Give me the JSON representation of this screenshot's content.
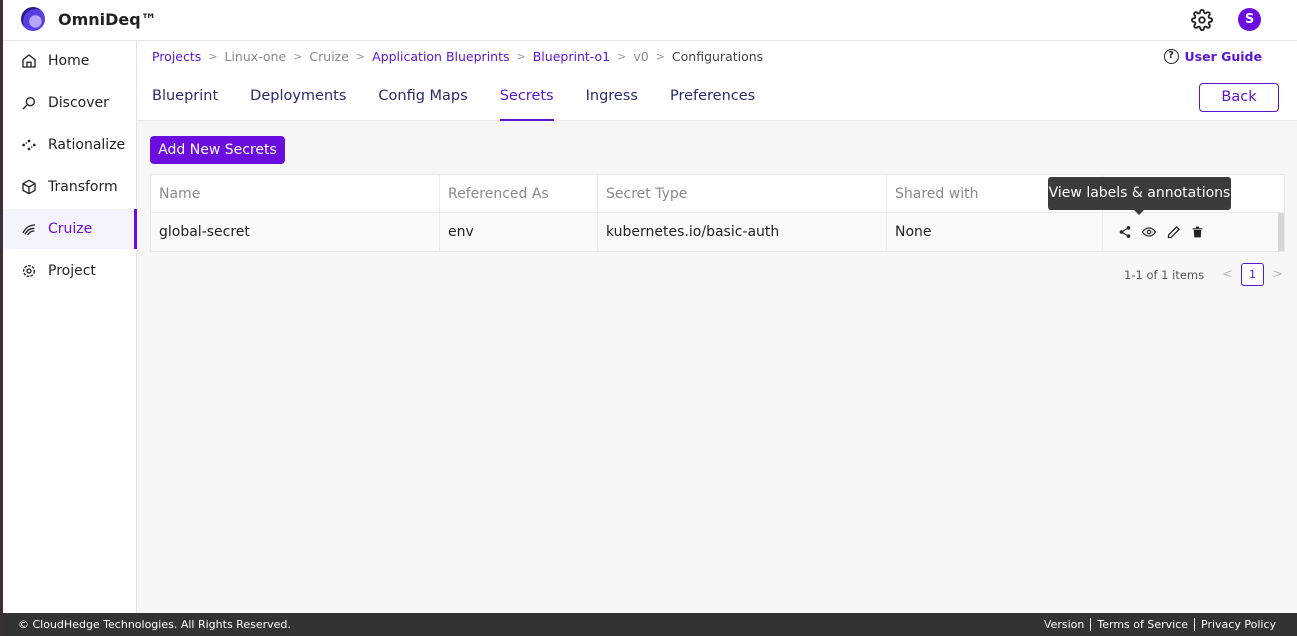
{
  "app": {
    "brand": "OmniDeq™",
    "avatar_letter": "S",
    "accent": "#6a0dde"
  },
  "sidebar": {
    "items": [
      {
        "label": "Home",
        "icon": "home-icon"
      },
      {
        "label": "Discover",
        "icon": "discover-icon"
      },
      {
        "label": "Rationalize",
        "icon": "rationalize-icon"
      },
      {
        "label": "Transform",
        "icon": "cube-icon"
      },
      {
        "label": "Cruize",
        "icon": "cruize-icon",
        "active": true
      },
      {
        "label": "Project",
        "icon": "gear-icon"
      }
    ]
  },
  "breadcrumb": [
    "Projects",
    "Linux-one",
    "Cruize",
    "Application Blueprints",
    "Blueprint-o1",
    "v0",
    "Configurations"
  ],
  "user_guide": "User Guide",
  "tabs": [
    "Blueprint",
    "Deployments",
    "Config Maps",
    "Secrets",
    "Ingress",
    "Preferences"
  ],
  "active_tab": "Secrets",
  "back_label": "Back",
  "add_button": "Add New Secrets",
  "table": {
    "headers": [
      "Name",
      "Referenced As",
      "Secret Type",
      "Shared with",
      ""
    ],
    "rows": [
      {
        "name": "global-secret",
        "referenced_as": "env",
        "secret_type": "kubernetes.io/basic-auth",
        "shared_with": "None"
      }
    ]
  },
  "tooltip": "View labels & annotations",
  "pagination": {
    "summary": "1-1 of 1 items",
    "page": "1"
  },
  "footer": {
    "copyright": "© CloudHedge Technologies. All Rights Reserved.",
    "links": [
      "Version",
      "Terms of Service",
      "Privacy Policy"
    ]
  }
}
